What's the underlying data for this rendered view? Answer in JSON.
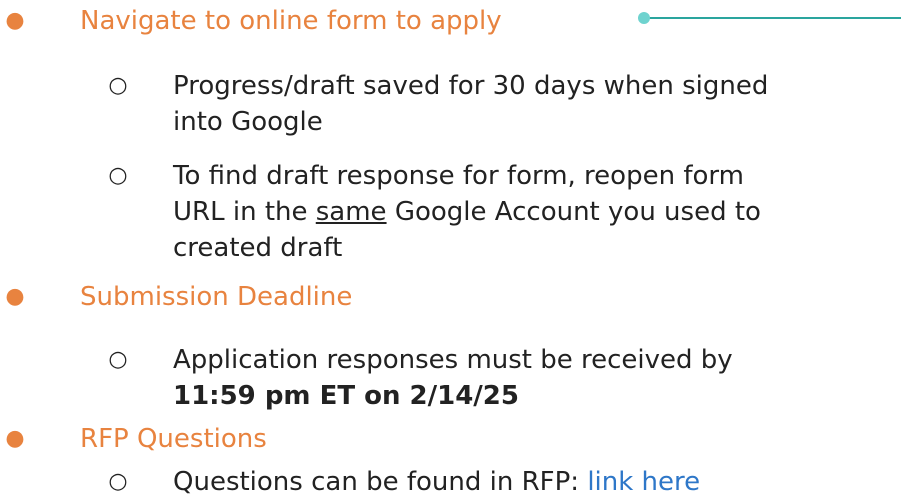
{
  "items": [
    {
      "label": "Navigate to online form to apply",
      "subitems": [
        {
          "lines": [
            "Progress/draft saved for 30 days when signed",
            "into Google"
          ]
        },
        {
          "line1": "To find draft response for form, reopen form",
          "line2_before": "URL in the ",
          "line2_underlined": "same",
          "line2_after": " Google Account you used to",
          "line3": "created draft"
        }
      ]
    },
    {
      "label": "Submission Deadline",
      "subitems": [
        {
          "line1": "Application responses must be received by",
          "line2_bold": "11:59 pm ET on 2/14/25"
        }
      ]
    },
    {
      "label": "RFP Questions",
      "subitems": [
        {
          "text_before": "Questions can be found in RFP: ",
          "link_text": "link here"
        }
      ]
    }
  ],
  "bullets": {
    "level1": "●",
    "level2": "○"
  },
  "colors": {
    "heading": "#e8833f",
    "body": "#222222",
    "link": "#2e77c8",
    "accent_line": "#2aa59e",
    "accent_dot": "#6fd3cf"
  }
}
